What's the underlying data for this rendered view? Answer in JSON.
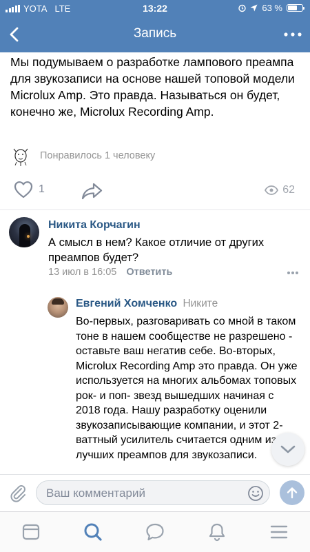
{
  "status": {
    "carrier": "YOTA",
    "network": "LTE",
    "time": "13:22",
    "battery_text": "63 %",
    "battery_level": 0.63
  },
  "nav": {
    "title": "Запись"
  },
  "post": {
    "text": "Мы подумываем о разработке лампового преампа для звукозаписи на основе нашей топовой модели Microlux Amp. Это правда. Называться он будет, конечно же, Microlux Recording Amp.",
    "liked_by": "Понравилось 1 человеку",
    "likes_count": "1",
    "views_count": "62"
  },
  "comments": [
    {
      "author": "Никита Корчагин",
      "text": "А смысл в нем? Какое отличие от других преампов будет?",
      "date": "13 июл в 16:05",
      "reply_label": "Ответить"
    },
    {
      "author": "Евгений Хомченко",
      "reply_to": "Никите",
      "text": "Во-первых, разговаривать со мной в таком тоне в нашем сообществе не разрешено - оставьте ваш негатив себе. Во-вторых, Microlux Recording Amp это правда. Он уже используется на многих альбомах топовых рок- и поп- звезд вышедших начиная с 2018 года. Нашу разработку оценили звукозаписывающие компании, и этот 2-ваттный усилитель считается одним из лучших преампов для звукозаписи."
    }
  ],
  "composer": {
    "placeholder": "Ваш комментарий"
  },
  "colors": {
    "header": "#5181b8",
    "link": "#2a5885",
    "muted": "#939393",
    "send_disabled": "#aac0dc"
  },
  "icons": {
    "back": "chevron-left-icon",
    "more": "more-dots-icon",
    "like": "heart-icon",
    "share": "share-arrow-icon",
    "views": "eye-icon",
    "attach": "paperclip-icon",
    "emoji": "smile-icon",
    "send": "arrow-up-icon",
    "scroll": "chevron-down-icon",
    "tabs": [
      "news-feed-icon",
      "search-icon",
      "messages-icon",
      "notifications-bell-icon",
      "menu-icon"
    ]
  }
}
